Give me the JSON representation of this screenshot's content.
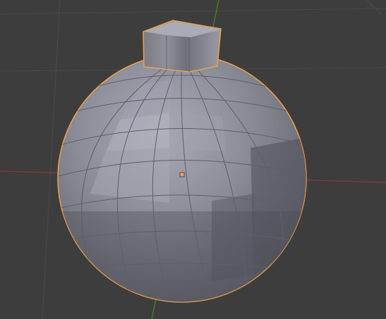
{
  "viewport": {
    "background": "#3d3d3d",
    "grid_color": "#4a4a4a",
    "x_axis_color": "#8f3636",
    "y_axis_color": "#3f8a1f",
    "selection_outline_color": "#f1a04a",
    "origin_color": "#f2a36b"
  },
  "object": {
    "shape": "low-poly sphere ornament with cylindrical cap",
    "selected": true
  }
}
